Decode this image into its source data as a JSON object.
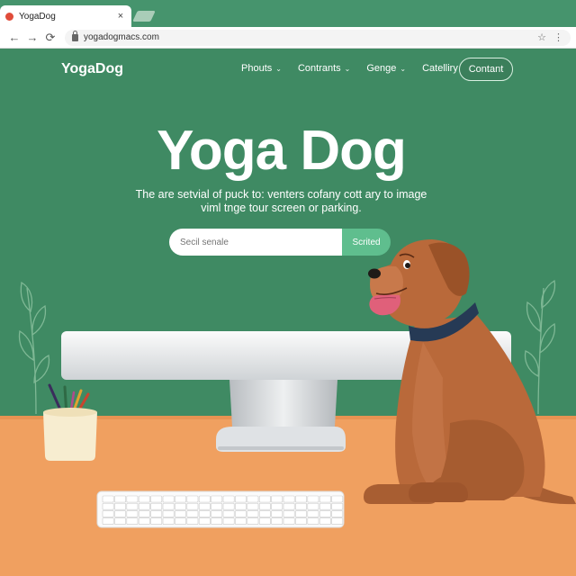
{
  "browser": {
    "tab_title": "YogaDog",
    "tab_close": "×",
    "url": "yogadogmacs.com",
    "nav": {
      "back": "←",
      "forward": "→",
      "reload": "⟳"
    }
  },
  "site": {
    "logo": "YogaDog",
    "menu": [
      {
        "label": "Phouts"
      },
      {
        "label": "Contrants"
      },
      {
        "label": "Genge"
      },
      {
        "label": "Catelliry"
      }
    ],
    "cta_label": "Contant"
  },
  "hero": {
    "title": "Yoga Dog",
    "subtitle_line1": "The are setvial of puck to: venters cofany cott ary to image",
    "subtitle_line2": "viml tnge tour screen or parking."
  },
  "search": {
    "placeholder": "Secil senale",
    "button_label": "Scrited"
  },
  "colors": {
    "background": "#3f8a63",
    "accent": "#5fbe8e",
    "desk": "#f0a060",
    "dog": "#b9693a"
  }
}
